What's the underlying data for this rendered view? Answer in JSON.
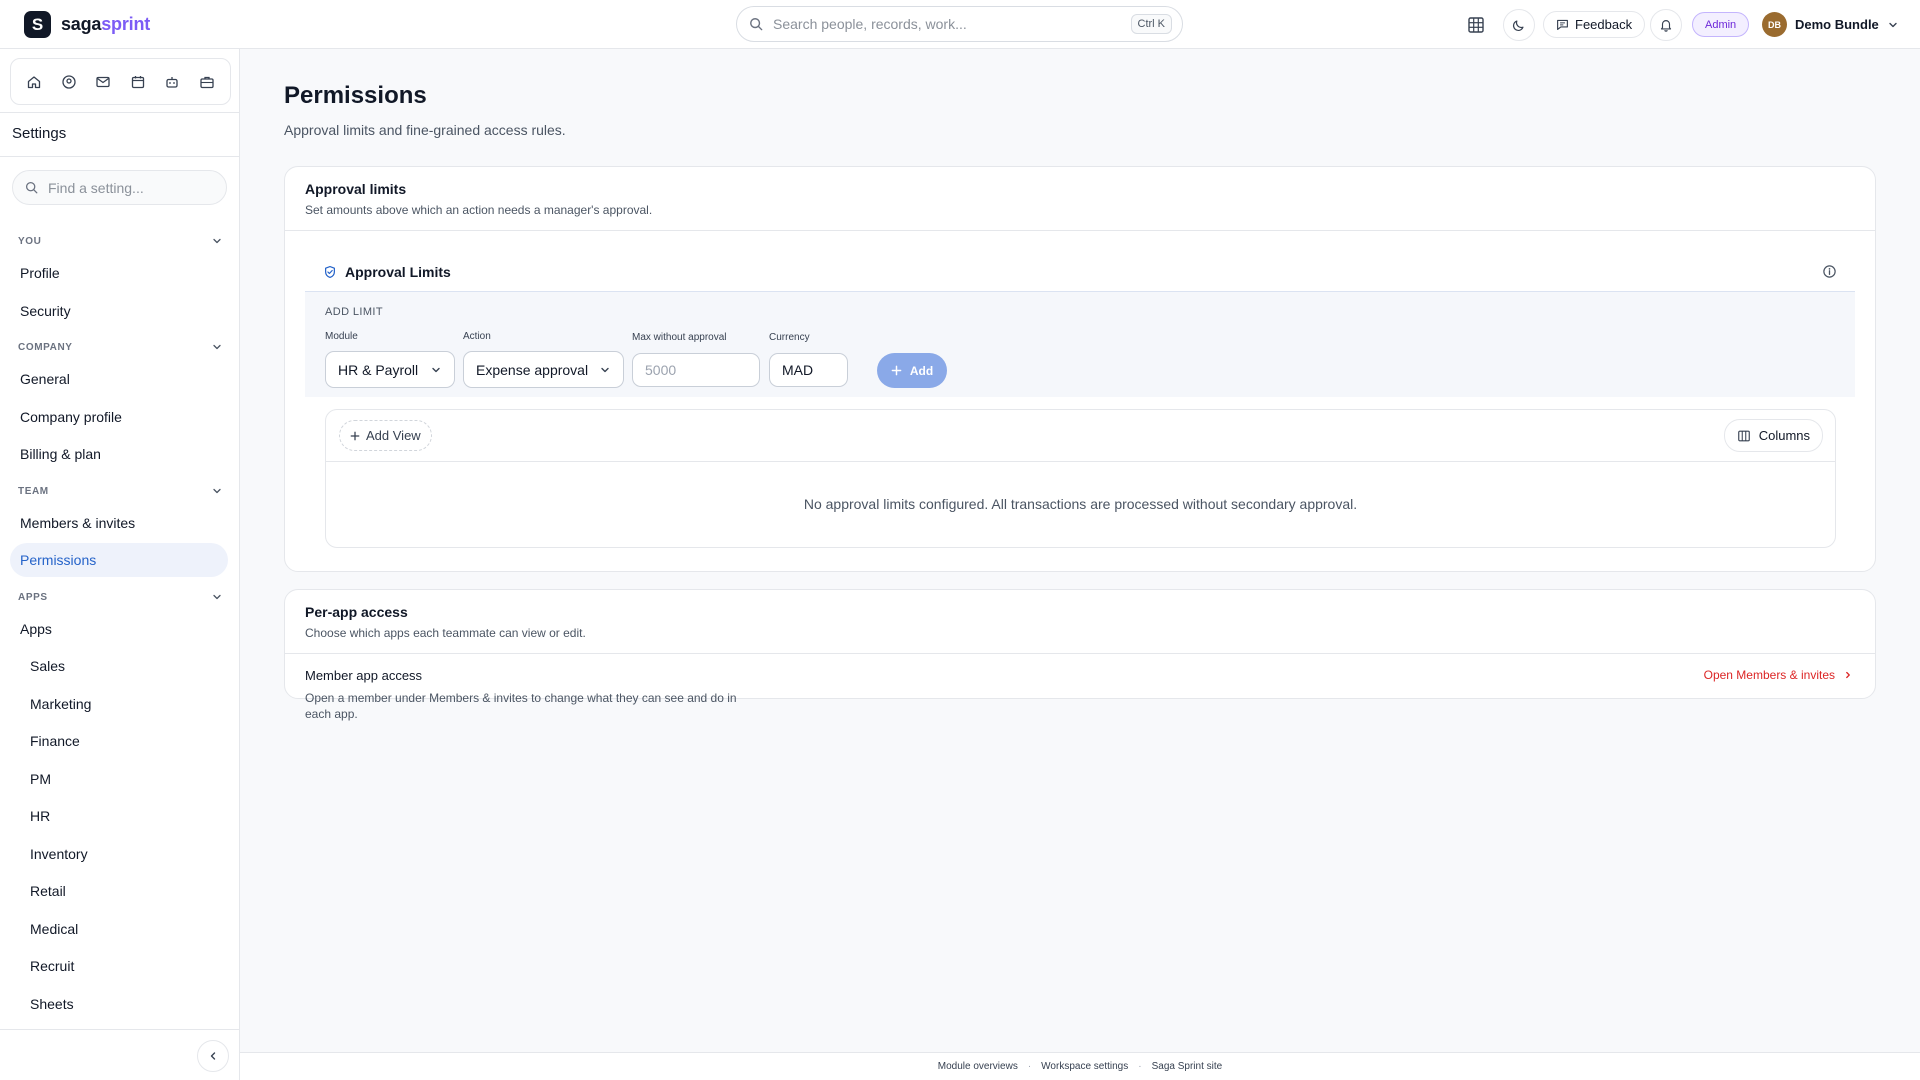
{
  "brand": {
    "name_part1": "saga",
    "name_part2": "sprint",
    "mark": "S"
  },
  "topbar": {
    "search_placeholder": "Search people, records, work...",
    "search_shortcut": "Ctrl K",
    "feedback_label": "Feedback",
    "role_badge": "Admin",
    "user_initials": "DB",
    "user_name": "Demo Bundle"
  },
  "sidebar": {
    "title": "Settings",
    "search_placeholder": "Find a setting...",
    "sections": {
      "you": "YOU",
      "company": "COMPANY",
      "team": "TEAM",
      "apps": "APPS"
    },
    "items": {
      "profile": "Profile",
      "security": "Security",
      "general": "General",
      "company_profile": "Company profile",
      "billing": "Billing & plan",
      "members": "Members & invites",
      "permissions": "Permissions",
      "apps": "Apps",
      "sales": "Sales",
      "marketing": "Marketing",
      "finance": "Finance",
      "pm": "PM",
      "hr": "HR",
      "inventory": "Inventory",
      "retail": "Retail",
      "medical": "Medical",
      "recruit": "Recruit",
      "sheets": "Sheets"
    },
    "active_item": "Permissions"
  },
  "page": {
    "title": "Permissions",
    "subtitle": "Approval limits and fine-grained access rules."
  },
  "approval_card": {
    "title": "Approval limits",
    "description": "Set amounts above which an action needs a manager's approval.",
    "panel_title": "Approval Limits",
    "add_limit_heading": "ADD LIMIT",
    "module_label": "Module",
    "module_value": "HR & Payroll",
    "action_label": "Action",
    "action_value": "Expense approval",
    "max_label": "Max without approval",
    "max_placeholder": "5000",
    "currency_label": "Currency",
    "currency_value": "MAD",
    "add_button": "Add",
    "add_view_button": "Add View",
    "columns_button": "Columns",
    "empty_message": "No approval limits configured. All transactions are processed without secondary approval."
  },
  "access_card": {
    "title": "Per-app access",
    "description": "Choose which apps each teammate can view or edit.",
    "row_title": "Member app access",
    "row_description": "Open a member under Members & invites to change what they can see and do in each app.",
    "link_label": "Open Members & invites"
  },
  "footer": {
    "links": [
      "Module overviews",
      "Workspace settings",
      "Saga Sprint site"
    ]
  },
  "colors": {
    "accent": "#2563c9",
    "brand_purple": "#7c5cf5",
    "link_red": "#dc2626",
    "add_button": "#8aa9e8"
  }
}
